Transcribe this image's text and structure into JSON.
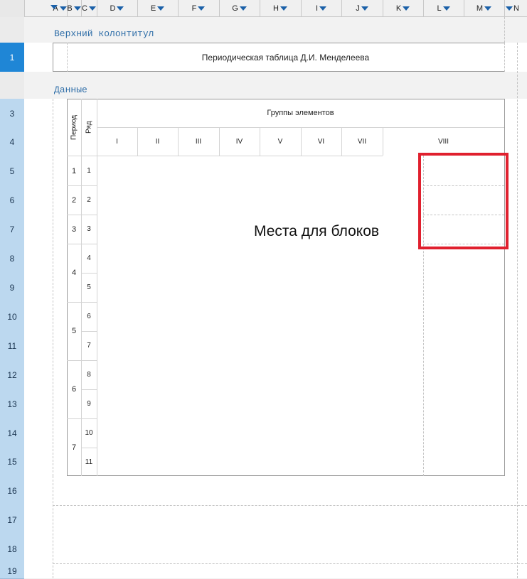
{
  "columns": [
    {
      "label": "A"
    },
    {
      "label": "B"
    },
    {
      "label": "C"
    },
    {
      "label": "D"
    },
    {
      "label": "E"
    },
    {
      "label": "F"
    },
    {
      "label": "G"
    },
    {
      "label": "H"
    },
    {
      "label": "I"
    },
    {
      "label": "J"
    },
    {
      "label": "K"
    },
    {
      "label": "L"
    },
    {
      "label": "M"
    },
    {
      "label": "N"
    }
  ],
  "rows": [
    "1",
    "3",
    "4",
    "5",
    "6",
    "7",
    "8",
    "9",
    "10",
    "11",
    "12",
    "13",
    "14",
    "15",
    "16",
    "17",
    "18",
    "19"
  ],
  "header_band": {
    "label": "Верхний колонтитул"
  },
  "data_band": {
    "label": "Данные"
  },
  "title": "Периодическая таблица Д.И. Менделеева",
  "table": {
    "period_header": "Период",
    "row_header": "Ряд",
    "groups_header": "Группы элементов",
    "groups": [
      "I",
      "II",
      "III",
      "IV",
      "V",
      "VI",
      "VII",
      "VIII"
    ],
    "periods": [
      "1",
      "2",
      "3",
      "4",
      "5",
      "6",
      "7"
    ],
    "series": [
      "1",
      "2",
      "3",
      "4",
      "5",
      "6",
      "7",
      "8",
      "9",
      "10",
      "11"
    ],
    "placeholder": "Места для блоков"
  },
  "colors": {
    "selection_outline": "#e0202e",
    "row_header": "#bcd8ef",
    "row_selected": "#1f86d6",
    "band_label": "#2f6ea8"
  }
}
